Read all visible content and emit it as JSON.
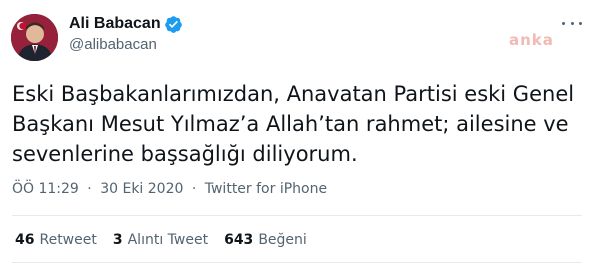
{
  "author": {
    "display_name": "Ali Babacan",
    "handle": "@alibabacan",
    "verified": true
  },
  "watermark": "anka",
  "tweet": {
    "text_lines": [
      "Eski Başbakanlarımızdan, Anavatan Partisi eski Genel",
      "Başkanı Mesut Yılmaz’a Allah’tan rahmet; ailesine ve",
      "sevenlerine başsağlığı diliyorum."
    ],
    "time": "ÖÖ 11:29",
    "separator": "·",
    "date": "30 Eki 2020",
    "source": "Twitter for iPhone"
  },
  "stats": {
    "retweets": {
      "count": "46",
      "label": "Retweet"
    },
    "quotes": {
      "count": "3",
      "label": "Alıntı Tweet"
    },
    "likes": {
      "count": "643",
      "label": "Beğeni"
    }
  },
  "colors": {
    "text": "#0f1419",
    "secondary": "#536471",
    "verified": "#1d9bf0",
    "watermark": "#f3b9b3",
    "divider": "#e7eaed"
  },
  "icons": {
    "verified": "verified-badge-icon",
    "more": "more-options-icon"
  }
}
